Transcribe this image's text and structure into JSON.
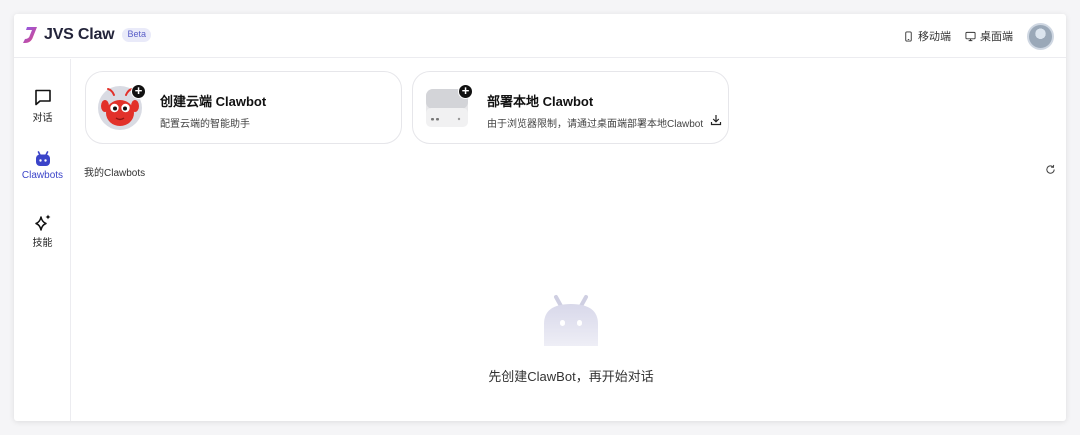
{
  "header": {
    "brand": "JVS Claw",
    "badge": "Beta",
    "mobile_label": "移动端",
    "desktop_label": "桌面端",
    "logo_color": "#6b4dd6"
  },
  "sidebar": {
    "items": [
      {
        "label": "对话",
        "icon": "chat-bubble-icon"
      },
      {
        "label": "Clawbots",
        "icon": "android-robot-icon",
        "active": true
      },
      {
        "label": "技能",
        "icon": "sparkle-icon"
      }
    ],
    "active_color": "#3b44c9"
  },
  "cards": [
    {
      "title": "创建云端 Clawbot",
      "desc": "配置云端的智能助手",
      "icon": "red-lobster-mascot"
    },
    {
      "title": "部署本地 Clawbot",
      "desc": "由于浏览器限制，请通过桌面端部署本地Clawbot",
      "icon": "mac-mini-device"
    }
  ],
  "section": {
    "title": "我的Clawbots"
  },
  "empty": {
    "message": "先创建ClawBot，再开始对话"
  }
}
